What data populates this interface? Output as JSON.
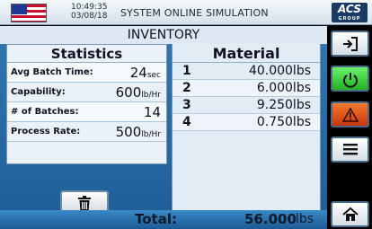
{
  "header": {
    "time": "10:49:35",
    "date": "03/08/18",
    "title": "SYSTEM ONLINE SIMULATION",
    "logo_text": "ACS",
    "logo_sub": "GROUP"
  },
  "inventory": {
    "title": "INVENTORY"
  },
  "statistics": {
    "heading": "Statistics",
    "rows": [
      {
        "label": "Avg Batch Time:",
        "value": "24",
        "unit": "sec"
      },
      {
        "label": "Capability:",
        "value": "600",
        "unit": "lb/Hr"
      },
      {
        "label": "# of Batches:",
        "value": "14",
        "unit": ""
      },
      {
        "label": "Process Rate:",
        "value": "500",
        "unit": "lb/Hr"
      }
    ]
  },
  "material": {
    "heading": "Material",
    "rows": [
      {
        "index": "1",
        "value": "40.000lbs"
      },
      {
        "index": "2",
        "value": "6.000lbs"
      },
      {
        "index": "3",
        "value": "9.250lbs"
      },
      {
        "index": "4",
        "value": "0.750lbs"
      }
    ]
  },
  "total": {
    "label": "Total:",
    "value": "56.000",
    "unit": "lbs"
  },
  "colors": {
    "panel_blue": "#2f79b4",
    "power_green": "#22b322",
    "alarm_red": "#c9360c"
  },
  "icons": {
    "trash": "trash-icon",
    "login": "login-icon",
    "power": "power-icon",
    "alarm": "alarm-icon",
    "menu": "menu-icon",
    "home": "home-icon"
  }
}
